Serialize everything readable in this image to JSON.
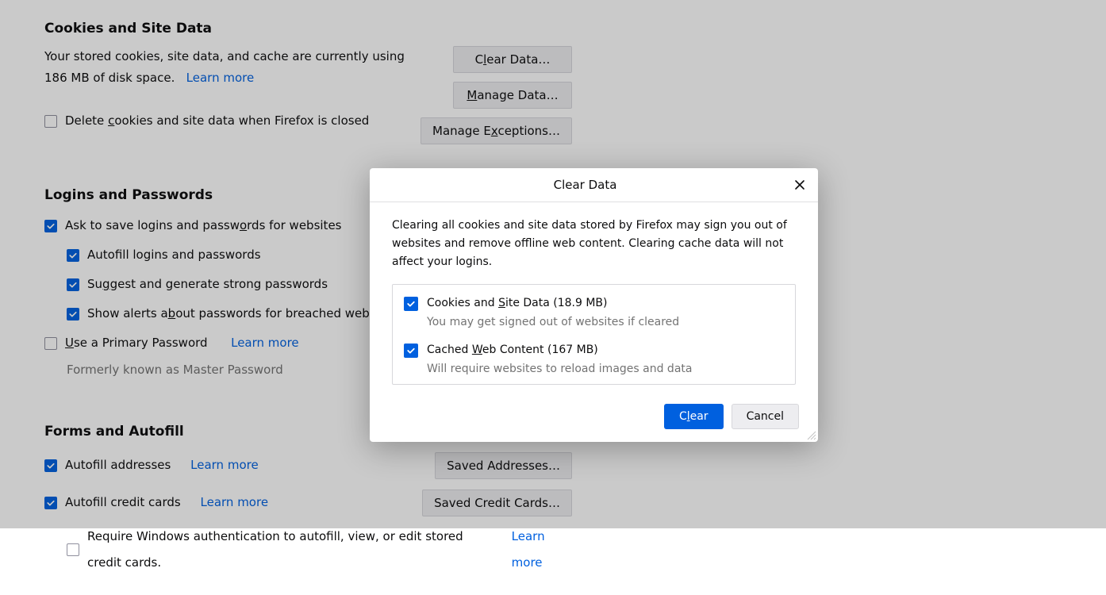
{
  "cookies": {
    "title": "Cookies and Site Data",
    "desc": "Your stored cookies, site data, and cache are currently using 186 MB of disk space.",
    "learn": "Learn more",
    "delete_label_pre": "Delete ",
    "delete_label_u": "c",
    "delete_label_post": "ookies and site data when Firefox is closed",
    "clear_btn_pre": "Clear Data",
    "clear_btn_post": "…",
    "clear_btn_u": "l",
    "manage_btn_pre": "",
    "manage_btn_u": "M",
    "manage_btn_post": "anage Data…",
    "exceptions_btn_pre": "Manage E",
    "exceptions_btn_u": "x",
    "exceptions_btn_post": "ceptions…"
  },
  "logins": {
    "title": "Logins and Passwords",
    "ask_pre": "Ask to save logins and passw",
    "ask_u": "o",
    "ask_post": "rds for websites",
    "autofill_pre": "Autof",
    "autofill_u": "i",
    "autofill_post": "ll logins and passwords",
    "suggest_pre": "Su",
    "suggest_u": "g",
    "suggest_post": "gest and generate strong passwords",
    "breach_pre": "Show alerts a",
    "breach_u": "b",
    "breach_post": "out passwords for breached websites",
    "primary_pre": "",
    "primary_u": "U",
    "primary_post": "se a Primary Password",
    "primary_learn": "Learn more",
    "formerly": "Formerly known as Master Password"
  },
  "forms": {
    "title": "Forms and Autofill",
    "addr_label": "Autofill addresses",
    "addr_learn": "Learn more",
    "addr_btn": "Saved Addresses…",
    "cc_label": "Autofill credit cards",
    "cc_learn": "Learn more",
    "cc_btn": "Saved Credit Cards…",
    "winauth_label": "Require Windows authentication to autofill, view, or edit stored credit cards.",
    "winauth_learn": "Learn more"
  },
  "dialog": {
    "title": "Clear Data",
    "msg": "Clearing all cookies and site data stored by Firefox may sign you out of websites and remove offline web content. Clearing cache data will not affect your logins.",
    "opt1_pre": "Cookies and ",
    "opt1_u": "S",
    "opt1_post": "ite Data (18.9 MB)",
    "opt1_sub": "You may get signed out of websites if cleared",
    "opt2_pre": "Cached ",
    "opt2_u": "W",
    "opt2_post": "eb Content (167 MB)",
    "opt2_sub": "Will require websites to reload images and data",
    "clear_pre": "C",
    "clear_u": "l",
    "clear_post": "ear",
    "cancel": "Cancel"
  }
}
